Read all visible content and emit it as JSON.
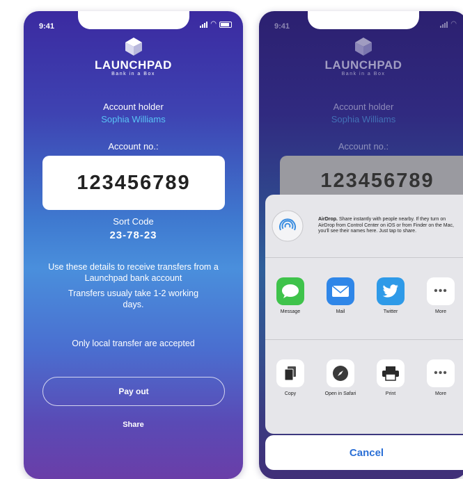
{
  "status": {
    "time": "9:41"
  },
  "logo": {
    "title": "LAUNCHPAD",
    "subtitle": "Bank in a Box"
  },
  "account": {
    "holder_label": "Account holder",
    "holder_name": "Sophia Williams",
    "number_label": "Account no.:",
    "number": "123456789",
    "sort_label": "Sort Code",
    "sort_code": "23-78-23"
  },
  "info": {
    "line1": "Use these details to receive transfers from a Launchpad bank account",
    "line2": "Transfers usualy take 1-2 working days.",
    "line3": "Only local transfer are accepted"
  },
  "actions": {
    "payout_label": "Pay out",
    "share_label": "Share"
  },
  "share_sheet": {
    "airdrop_title": "AirDrop.",
    "airdrop_text": "Share instantly with people nearby. If they turn on AirDrop from Control Center on iOS or from Finder on the Mac, you'll see their names here. Just tap to share.",
    "apps": [
      {
        "label": "Message",
        "icon": "message-icon",
        "color": "#3fc34b"
      },
      {
        "label": "Mail",
        "icon": "mail-icon",
        "color": "#2f86e8"
      },
      {
        "label": "Twitter",
        "icon": "twitter-icon",
        "color": "#2e9ae8"
      },
      {
        "label": "More",
        "icon": "more-icon",
        "color": "#ffffff"
      }
    ],
    "actions": [
      {
        "label": "Copy",
        "icon": "copy-icon"
      },
      {
        "label": "Open in Safari",
        "icon": "safari-icon"
      },
      {
        "label": "Print",
        "icon": "print-icon"
      },
      {
        "label": "More",
        "icon": "more-icon"
      }
    ],
    "cancel_label": "Cancel"
  },
  "colors": {
    "accent_blue": "#59c3f5",
    "cancel_blue": "#2a6fd6",
    "gradient_top": "#3b2aa0",
    "gradient_mid": "#4a8fdc",
    "gradient_bottom": "#6a3ea8"
  }
}
